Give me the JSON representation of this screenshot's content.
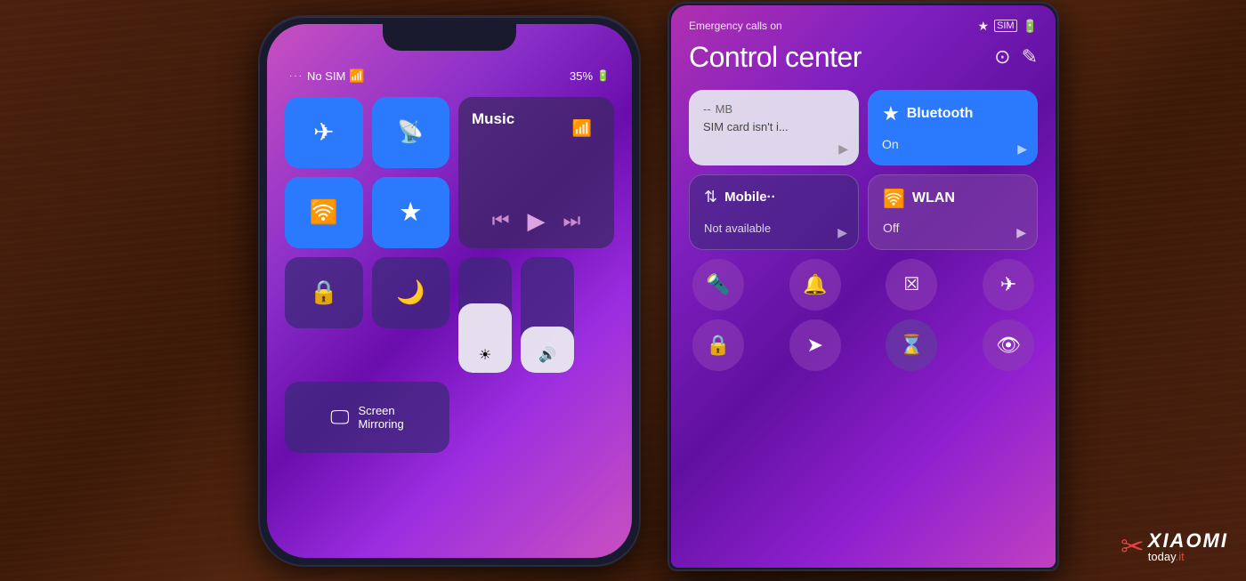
{
  "background": {
    "color": "#3a1808"
  },
  "iphone": {
    "status": {
      "signal": "···",
      "network": "No SIM",
      "wifi": "WiFi",
      "battery": "35%"
    },
    "control_center": {
      "tiles": [
        {
          "id": "airplane",
          "label": "Airplane Mode",
          "active": true,
          "icon": "✈"
        },
        {
          "id": "cellular",
          "label": "Cellular Data",
          "active": true,
          "icon": "📡"
        },
        {
          "id": "wifi",
          "label": "Wi-Fi",
          "active": true,
          "icon": "WiFi"
        },
        {
          "id": "bluetooth",
          "label": "Bluetooth",
          "active": true,
          "icon": "⬢"
        },
        {
          "id": "music",
          "label": "Music",
          "active": false
        },
        {
          "id": "lock-rotation",
          "label": "Orientation Lock",
          "active": false,
          "icon": "🔒"
        },
        {
          "id": "do-not-disturb",
          "label": "Do Not Disturb",
          "active": false,
          "icon": "🌙"
        },
        {
          "id": "screen-mirror",
          "label": "Screen Mirroring",
          "icon": "▭"
        },
        {
          "id": "brightness",
          "label": "Brightness",
          "value": 60
        },
        {
          "id": "volume",
          "label": "Volume",
          "value": 40
        }
      ],
      "music_label": "Music",
      "screen_mirroring_label": "Screen\nMirroring"
    }
  },
  "xiaomi": {
    "status_bar": {
      "left": "Emergency calls on",
      "bluetooth_icon": "⊕",
      "sim_icon": "SIM",
      "battery_icon": "🔋"
    },
    "title": "Control center",
    "icons": {
      "settings": "⊙",
      "edit": "✎"
    },
    "tiles": [
      {
        "id": "sim",
        "title": "SIM card isn't i...",
        "subtitle": "-- MB",
        "bg": "light",
        "icon": null
      },
      {
        "id": "bluetooth",
        "title": "Bluetooth",
        "subtitle": "On",
        "bg": "blue",
        "icon": "⊕"
      },
      {
        "id": "mobile",
        "title": "Mobile··",
        "subtitle": "Not available",
        "bg": "dark",
        "icon": "⇅"
      },
      {
        "id": "wlan",
        "title": "WLAN",
        "subtitle": "Off",
        "bg": "purple",
        "icon": "WiFi"
      }
    ],
    "icon_buttons_row1": [
      {
        "id": "flashlight",
        "icon": "🔦",
        "label": "Flashlight"
      },
      {
        "id": "bell",
        "icon": "🔔",
        "label": "Bell"
      },
      {
        "id": "screenshot",
        "icon": "⊞",
        "label": "Screenshot"
      },
      {
        "id": "airplane",
        "icon": "✈",
        "label": "Airplane Mode"
      }
    ],
    "icon_buttons_row2": [
      {
        "id": "lock",
        "icon": "🔒",
        "label": "Lock"
      },
      {
        "id": "location",
        "icon": "➤",
        "label": "Location"
      },
      {
        "id": "timer",
        "icon": "⊛",
        "label": "Timer"
      },
      {
        "id": "eye",
        "icon": "👁",
        "label": "Eye"
      }
    ]
  },
  "watermark": {
    "brand": "XIAOMI",
    "today": "today",
    "tld": ".it"
  }
}
